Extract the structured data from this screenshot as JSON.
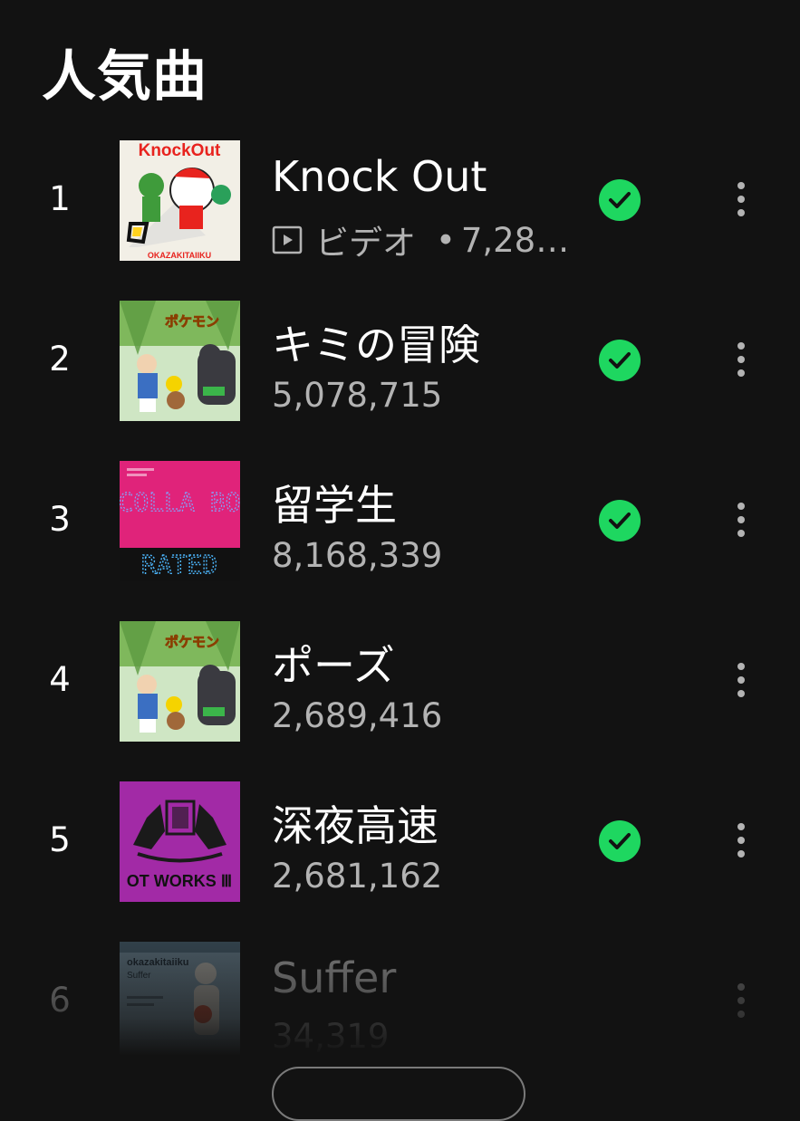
{
  "section": {
    "title": "人気曲"
  },
  "tracks": [
    {
      "rank": "1",
      "title": "Knock Out",
      "video_label": "ビデオ",
      "plays": "7,28…",
      "has_video": true,
      "downloaded": true,
      "cover": "knockout-cover",
      "cover_text": "KnockOut",
      "cover_caption": "OKAZAKITAIIKU"
    },
    {
      "rank": "2",
      "title": "キミの冒険",
      "plays": "5,078,715",
      "has_video": false,
      "downloaded": true,
      "cover": "pokemon-coco-cover"
    },
    {
      "rank": "3",
      "title": "留学生",
      "plays": "8,168,339",
      "has_video": false,
      "downloaded": true,
      "cover": "collabo-rated-cover",
      "cover_text": "COLLA BO",
      "cover_caption": "RATED"
    },
    {
      "rank": "4",
      "title": "ポーズ",
      "plays": "2,689,416",
      "has_video": false,
      "downloaded": false,
      "cover": "pokemon-coco-cover"
    },
    {
      "rank": "5",
      "title": "深夜高速",
      "plays": "2,681,162",
      "has_video": false,
      "downloaded": true,
      "cover": "ot-works-cover",
      "cover_caption": "OT WORKS Ⅲ"
    },
    {
      "rank": "6",
      "title": "Suffer",
      "plays": "34,319",
      "has_video": false,
      "downloaded": false,
      "cover": "suffer-cover",
      "cover_text": "okazakitaiiku",
      "cover_caption": "Suffer"
    }
  ],
  "colors": {
    "background": "#121212",
    "accent": "#1ed760",
    "secondary_text": "#b3b3b3"
  }
}
